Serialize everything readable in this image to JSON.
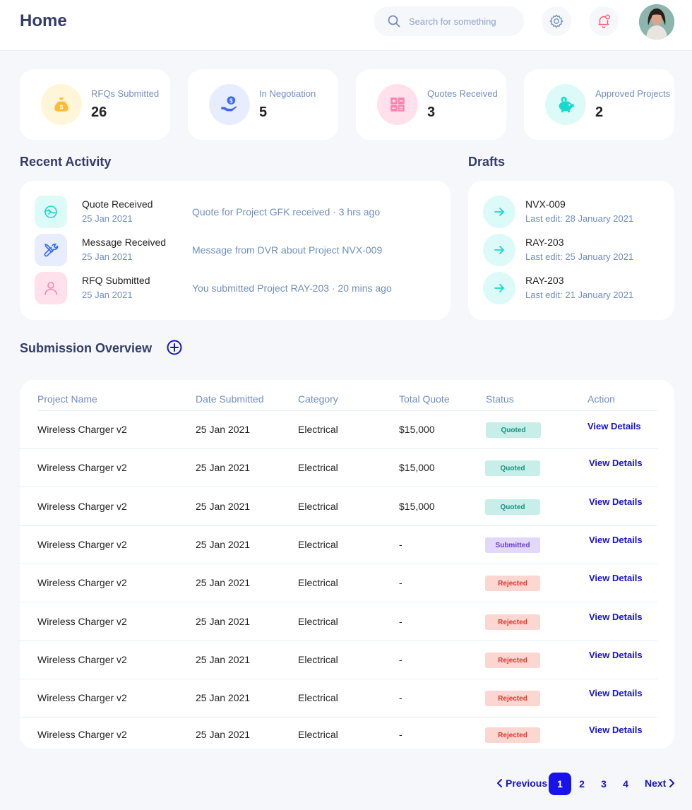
{
  "header": {
    "title": "Home",
    "search_placeholder": "Search for something",
    "icons": {
      "search": "search-icon",
      "settings": "gear-icon",
      "notifications": "bell-icon",
      "avatar": "avatar"
    },
    "notification_dot_color": "#fe5c73"
  },
  "stats": [
    {
      "label": "RFQs Submitted",
      "value": "26",
      "icon": "money-bag-icon",
      "bg": "#fff5d9",
      "color": "#ffbb38"
    },
    {
      "label": "In Negotiation",
      "value": "5",
      "icon": "hand-coin-icon",
      "bg": "#e7edff",
      "color": "#396aff"
    },
    {
      "label": "Quotes Received",
      "value": "3",
      "icon": "calculator-icon",
      "bg": "#ffe0eb",
      "color": "#ff82ac"
    },
    {
      "label": "Approved Projects",
      "value": "2",
      "icon": "piggy-bank-icon",
      "bg": "#dcfaf8",
      "color": "#16dbcc"
    }
  ],
  "recent_activity": {
    "title": "Recent Activity",
    "items": [
      {
        "title": "Quote Received",
        "date": "25 Jan 2021",
        "description": "Quote for Project GFK received · 3 hrs ago",
        "icon": "quote-received-icon",
        "bg": "#dcfaf8",
        "color": "#16dbcc"
      },
      {
        "title": "Message Received",
        "date": "25 Jan 2021",
        "description": "Message from DVR about Project NVX-009",
        "icon": "tools-icon",
        "bg": "#e7edff",
        "color": "#396aff"
      },
      {
        "title": "RFQ Submitted",
        "date": "25 Jan 2021",
        "description": "You submitted Project RAY-203 · 20 mins ago",
        "icon": "user-icon",
        "bg": "#ffe0eb",
        "color": "#ff82ac"
      }
    ]
  },
  "drafts": {
    "title": "Drafts",
    "items": [
      {
        "name": "NVX-009",
        "edited": "Last edit: 28 January 2021"
      },
      {
        "name": "RAY-203",
        "edited": "Last edit: 25 January 2021"
      },
      {
        "name": "RAY-203",
        "edited": "Last edit: 21 January 2021"
      }
    ]
  },
  "submission_overview": {
    "title": "Submission Overview",
    "columns": [
      "Project Name",
      "Date Submitted",
      "Category",
      "Total Quote",
      "Status",
      "Action"
    ],
    "rows": [
      {
        "project": "Wireless Charger v2",
        "date": "25 Jan 2021",
        "category": "Electrical",
        "quote": "$15,000",
        "status": "Quoted",
        "action": "View Details"
      },
      {
        "project": "Wireless Charger v2",
        "date": "25 Jan 2021",
        "category": "Electrical",
        "quote": "$15,000",
        "status": "Quoted",
        "action": "View Details"
      },
      {
        "project": "Wireless Charger v2",
        "date": "25 Jan 2021",
        "category": "Electrical",
        "quote": "$15,000",
        "status": "Quoted",
        "action": "View Details"
      },
      {
        "project": "Wireless Charger v2",
        "date": "25 Jan 2021",
        "category": "Electrical",
        "quote": "-",
        "status": "Submitted",
        "action": "View Details"
      },
      {
        "project": "Wireless Charger v2",
        "date": "25 Jan 2021",
        "category": "Electrical",
        "quote": "-",
        "status": "Rejected",
        "action": "View Details"
      },
      {
        "project": "Wireless Charger v2",
        "date": "25 Jan 2021",
        "category": "Electrical",
        "quote": "-",
        "status": "Rejected",
        "action": "View Details"
      },
      {
        "project": "Wireless Charger v2",
        "date": "25 Jan 2021",
        "category": "Electrical",
        "quote": "-",
        "status": "Rejected",
        "action": "View Details"
      },
      {
        "project": "Wireless Charger v2",
        "date": "25 Jan 2021",
        "category": "Electrical",
        "quote": "-",
        "status": "Rejected",
        "action": "View Details"
      },
      {
        "project": "Wireless Charger v2",
        "date": "25 Jan 2021",
        "category": "Electrical",
        "quote": "-",
        "status": "Rejected",
        "action": "View Details"
      }
    ]
  },
  "pagination": {
    "previous": "Previous",
    "next": "Next",
    "pages": [
      "1",
      "2",
      "3",
      "4"
    ],
    "current": "1"
  },
  "colors": {
    "accent": "#1814e8",
    "link": "#1814c8",
    "muted": "#718ebf",
    "heading": "#343c6a"
  }
}
